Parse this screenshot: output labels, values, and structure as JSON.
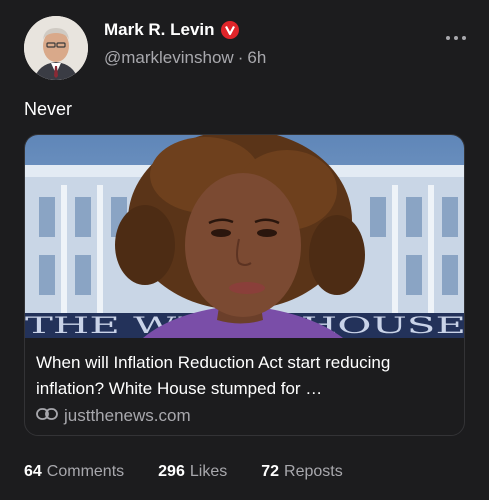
{
  "post": {
    "author_name": "Mark R. Levin",
    "handle": "@marklevinshow",
    "separator": "·",
    "time": "6h",
    "text": "Never"
  },
  "link_card": {
    "title": "When will Inflation Reduction Act start reducing inflation? White House stumped for …",
    "domain": "justthenews.com",
    "backdrop_text": "THE WHITE HOUSE"
  },
  "stats": {
    "comments_count": "64",
    "comments_label": "Comments",
    "likes_count": "296",
    "likes_label": "Likes",
    "reposts_count": "72",
    "reposts_label": "Reposts"
  },
  "icons": {
    "more": "more-dots-icon",
    "verified": "verified-badge-icon",
    "link": "link-icon"
  },
  "colors": {
    "background": "#1c1c1e",
    "verified_badge": "#e0252a",
    "secondary_text": "#a8a8ad"
  }
}
